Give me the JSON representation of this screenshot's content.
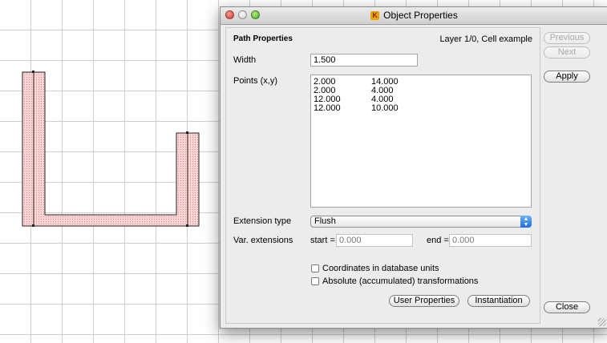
{
  "window": {
    "title": "Object Properties",
    "app_icon": "klayout-app-icon"
  },
  "panel": {
    "heading": "Path Properties",
    "layer_cell": "Layer 1/0, Cell example",
    "width_label": "Width",
    "width_value": "1.500",
    "points_label": "Points (x,y)",
    "points": [
      {
        "x": "2.000",
        "y": "14.000"
      },
      {
        "x": "2.000",
        "y": "4.000"
      },
      {
        "x": "12.000",
        "y": "4.000"
      },
      {
        "x": "12.000",
        "y": "10.000"
      }
    ],
    "extension_label": "Extension type",
    "extension_value": "Flush",
    "var_ext_label": "Var. extensions",
    "start_label": "start =",
    "start_value": "0.000",
    "end_label": "end =",
    "end_value": "0.000",
    "check_dbu": "Coordinates in database units",
    "check_abs": "Absolute (accumulated) transformations",
    "user_props_button": "User Properties",
    "instantiation_button": "Instantiation"
  },
  "side": {
    "previous_button": "Previous",
    "next_button": "Next",
    "apply_button": "Apply",
    "close_button": "Close"
  },
  "colors": {
    "path_fill": "#f6c9c9",
    "path_hatch": "#e07a7a",
    "grid": "#cfcfcf"
  }
}
